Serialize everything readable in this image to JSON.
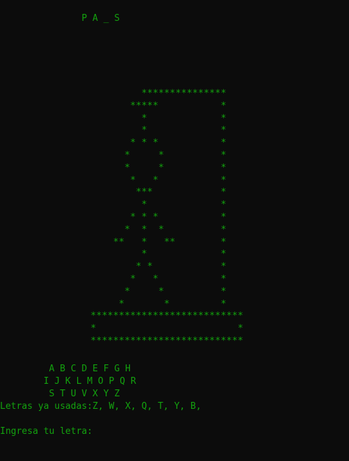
{
  "console": {
    "colors": {
      "background": "#0c0c0c",
      "text": "#13a10e"
    },
    "word_display": "               P A _ S",
    "hangman_art": [
      "                         ***************",
      "                       *****           *",
      "                         *             *",
      "                         *             *",
      "                       * * *           *",
      "                      *     *          *",
      "                      *     *          *",
      "                       *   *           *",
      "                        ***            *",
      "                         *             *",
      "                       * * *           *",
      "                      *  *  *          *",
      "                    **   *   **        *",
      "                         *             *",
      "                        * *            *",
      "                       *   *           *",
      "                      *     *          *",
      "                     *       *         *",
      "                ***************************",
      "                *                         *",
      "                ***************************"
    ],
    "alphabet_rows": [
      "         A B C D E F G H",
      "        I J K L M O P Q R",
      "         S T U V X Y Z"
    ],
    "used_letters_line": "Letras ya usadas:Z, W, X, Q, T, Y, B,",
    "input_prompt": "Ingresa tu letra:"
  }
}
